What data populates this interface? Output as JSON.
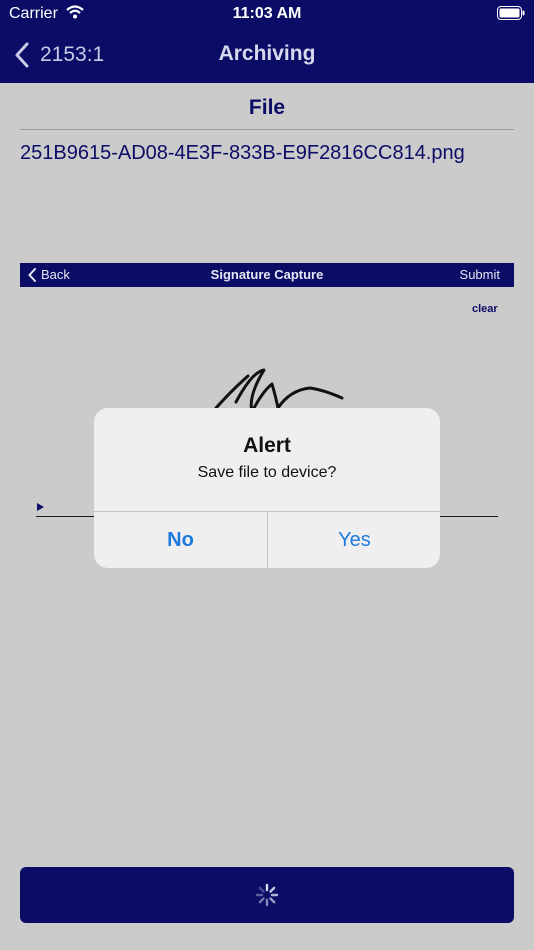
{
  "status_bar": {
    "carrier": "Carrier",
    "time": "11:03 AM"
  },
  "nav": {
    "back_label": "2153:1",
    "title": "Archiving"
  },
  "file_section": {
    "heading": "File",
    "file_name": "251B9615-AD08-4E3F-833B-E9F2816CC814.png"
  },
  "signature_capture": {
    "back_label": "Back",
    "title": "Signature Capture",
    "submit_label": "Submit",
    "clear_label": "clear"
  },
  "alert": {
    "title": "Alert",
    "message": "Save file to device?",
    "no_label": "No",
    "yes_label": "Yes"
  },
  "colors": {
    "brand": "#0b0c66",
    "background": "#cbcbcb",
    "alert_button": "#1f7ae0"
  },
  "icons": [
    "wifi-icon",
    "battery-icon",
    "chevron-left-icon",
    "spinner-icon"
  ]
}
